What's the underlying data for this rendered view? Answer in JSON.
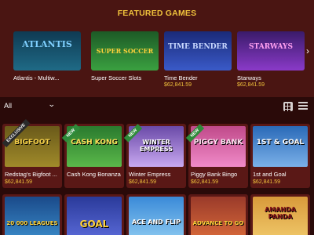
{
  "featured": {
    "title": "FEATURED GAMES",
    "items": [
      {
        "name": "Atlantis - Multiw...",
        "prize": "",
        "logo": "ATLANTIS",
        "bg": "#0f3a52",
        "accent": "#7fd0ff"
      },
      {
        "name": "Super Soccer Slots",
        "prize": "",
        "logo": "SUPER SOCCER",
        "bg": "#1d5a26",
        "accent": "#ffd23a"
      },
      {
        "name": "Time Bender",
        "prize": "$62,841.59",
        "logo": "TIME BENDER",
        "bg": "#1a2a78",
        "accent": "#c9d8ff"
      },
      {
        "name": "Starways",
        "prize": "$62,841.59",
        "logo": "STARWAYS",
        "bg": "#3a1b6a",
        "accent": "#ffa0f0"
      }
    ]
  },
  "filter": {
    "selected": "All"
  },
  "games_row1": [
    {
      "name": "Redstag's Bigfoot ...",
      "prize": "$62,841.59",
      "badge": "EXCLUSIVE",
      "logo": "BIGFOOT",
      "bg": "#6a5a1a",
      "accent": "#f5d04a"
    },
    {
      "name": "Cash Kong Bonanza",
      "prize": "",
      "badge": "NEW",
      "logo": "CASH KONG",
      "bg": "#2a7a2e",
      "accent": "#ffe05a"
    },
    {
      "name": "Winter Empress",
      "prize": "$62,841.59",
      "badge": "NEW",
      "logo": "WINTER EMPRESS",
      "bg": "#6a4aa8",
      "accent": "#ffffff"
    },
    {
      "name": "Piggy Bank Bingo",
      "prize": "$62,841.59",
      "badge": "NEW",
      "logo": "PIGGY BANK",
      "bg": "#c04a8a",
      "accent": "#ffe3f2"
    },
    {
      "name": "1st and Goal",
      "prize": "$62,841.59",
      "badge": "",
      "logo": "1ST & GOAL",
      "bg": "#2a6ab8",
      "accent": "#ffffff"
    }
  ],
  "games_row2": [
    {
      "logo": "20 000 LEAGUES",
      "bg": "#1a4a8a",
      "accent": "#ffd23a"
    },
    {
      "logo": "GOAL",
      "bg": "#2a3a9a",
      "accent": "#ffd23a"
    },
    {
      "logo": "ACE AND FLIP",
      "bg": "#3a8ad8",
      "accent": "#ffffff"
    },
    {
      "logo": "ADVANCE TO GO",
      "bg": "#9a3a2a",
      "accent": "#ffd23a"
    },
    {
      "logo": "AMANDA PANDA",
      "bg": "#d89a3a",
      "accent": "#8a1a1a"
    }
  ]
}
